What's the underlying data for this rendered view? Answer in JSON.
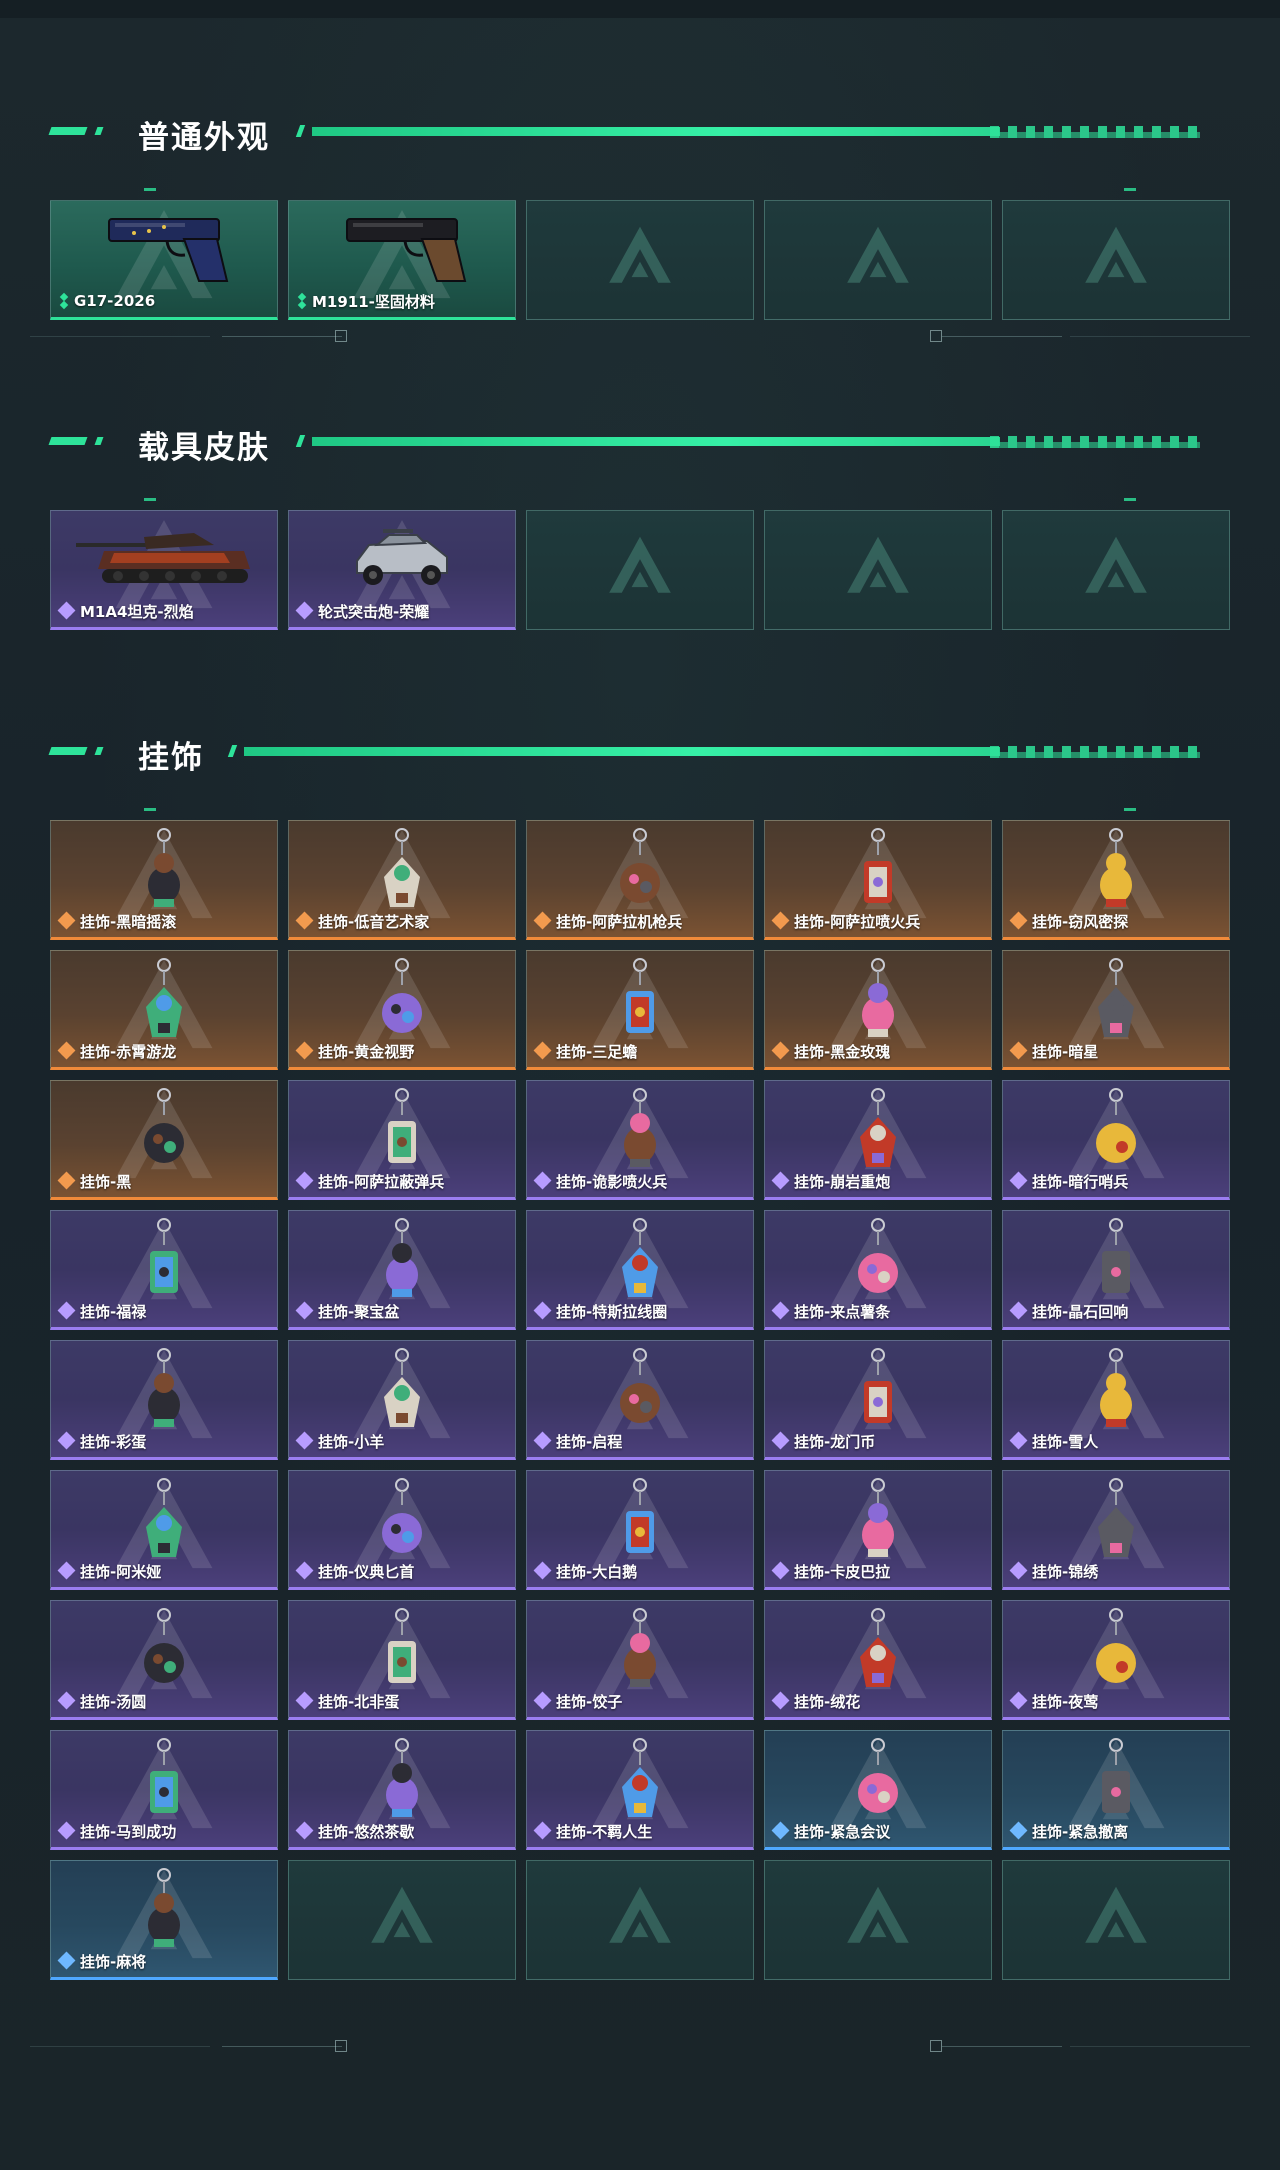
{
  "colors": {
    "accent": "#2ee39a",
    "rarity_green": "#2ee39a",
    "rarity_purple": "#9b7df0",
    "rarity_orange": "#f08a3a",
    "rarity_blue": "#4fa8ff"
  },
  "sections": [
    {
      "title": "普通外观",
      "items": [
        {
          "label": "G17-2026",
          "rarity": "green",
          "icon": "pistol-icon"
        },
        {
          "label": "M1911-坚固材料",
          "rarity": "green",
          "icon": "pistol-icon"
        },
        {
          "label": "",
          "rarity": "empty",
          "icon": "logo-placeholder-icon"
        },
        {
          "label": "",
          "rarity": "empty",
          "icon": "logo-placeholder-icon"
        },
        {
          "label": "",
          "rarity": "empty",
          "icon": "logo-placeholder-icon"
        }
      ]
    },
    {
      "title": "载具皮肤",
      "items": [
        {
          "label": "M1A4坦克-烈焰",
          "rarity": "purple",
          "icon": "tank-icon"
        },
        {
          "label": "轮式突击炮-荣耀",
          "rarity": "purple",
          "icon": "armored-vehicle-icon"
        },
        {
          "label": "",
          "rarity": "empty",
          "icon": "logo-placeholder-icon"
        },
        {
          "label": "",
          "rarity": "empty",
          "icon": "logo-placeholder-icon"
        },
        {
          "label": "",
          "rarity": "empty",
          "icon": "logo-placeholder-icon"
        }
      ]
    },
    {
      "title": "挂饰",
      "items": [
        {
          "label": "挂饰-黑暗摇滚",
          "rarity": "orange",
          "icon": "charm-icon"
        },
        {
          "label": "挂饰-低音艺术家",
          "rarity": "orange",
          "icon": "charm-icon"
        },
        {
          "label": "挂饰-阿萨拉机枪兵",
          "rarity": "orange",
          "icon": "charm-icon"
        },
        {
          "label": "挂饰-阿萨拉喷火兵",
          "rarity": "orange",
          "icon": "charm-icon"
        },
        {
          "label": "挂饰-窃风密探",
          "rarity": "orange",
          "icon": "charm-icon"
        },
        {
          "label": "挂饰-赤霄游龙",
          "rarity": "orange",
          "icon": "charm-icon"
        },
        {
          "label": "挂饰-黄金视野",
          "rarity": "orange",
          "icon": "charm-icon"
        },
        {
          "label": "挂饰-三足蟾",
          "rarity": "orange",
          "icon": "charm-icon"
        },
        {
          "label": "挂饰-黑金玫瑰",
          "rarity": "orange",
          "icon": "charm-icon"
        },
        {
          "label": "挂饰-暗星",
          "rarity": "orange",
          "icon": "charm-icon"
        },
        {
          "label": "挂饰-黑",
          "rarity": "orange",
          "icon": "charm-icon"
        },
        {
          "label": "挂饰-阿萨拉蔽弹兵",
          "rarity": "purple",
          "icon": "charm-icon"
        },
        {
          "label": "挂饰-诡影喷火兵",
          "rarity": "purple",
          "icon": "charm-icon"
        },
        {
          "label": "挂饰-崩岩重炮",
          "rarity": "purple",
          "icon": "charm-icon"
        },
        {
          "label": "挂饰-暗行哨兵",
          "rarity": "purple",
          "icon": "charm-icon"
        },
        {
          "label": "挂饰-福禄",
          "rarity": "purple",
          "icon": "charm-icon"
        },
        {
          "label": "挂饰-聚宝盆",
          "rarity": "purple",
          "icon": "charm-icon"
        },
        {
          "label": "挂饰-特斯拉线圈",
          "rarity": "purple",
          "icon": "charm-icon"
        },
        {
          "label": "挂饰-来点薯条",
          "rarity": "purple",
          "icon": "charm-icon"
        },
        {
          "label": "挂饰-晶石回响",
          "rarity": "purple",
          "icon": "charm-icon"
        },
        {
          "label": "挂饰-彩蛋",
          "rarity": "purple",
          "icon": "charm-icon"
        },
        {
          "label": "挂饰-小羊",
          "rarity": "purple",
          "icon": "charm-icon"
        },
        {
          "label": "挂饰-启程",
          "rarity": "purple",
          "icon": "charm-icon"
        },
        {
          "label": "挂饰-龙门币",
          "rarity": "purple",
          "icon": "charm-icon"
        },
        {
          "label": "挂饰-雪人",
          "rarity": "purple",
          "icon": "charm-icon"
        },
        {
          "label": "挂饰-阿米娅",
          "rarity": "purple",
          "icon": "charm-icon"
        },
        {
          "label": "挂饰-仪典匕首",
          "rarity": "purple",
          "icon": "charm-icon"
        },
        {
          "label": "挂饰-大白鹅",
          "rarity": "purple",
          "icon": "charm-icon"
        },
        {
          "label": "挂饰-卡皮巴拉",
          "rarity": "purple",
          "icon": "charm-icon"
        },
        {
          "label": "挂饰-锦绣",
          "rarity": "purple",
          "icon": "charm-icon"
        },
        {
          "label": "挂饰-汤圆",
          "rarity": "purple",
          "icon": "charm-icon"
        },
        {
          "label": "挂饰-北非蛋",
          "rarity": "purple",
          "icon": "charm-icon"
        },
        {
          "label": "挂饰-饺子",
          "rarity": "purple",
          "icon": "charm-icon"
        },
        {
          "label": "挂饰-绒花",
          "rarity": "purple",
          "icon": "charm-icon"
        },
        {
          "label": "挂饰-夜莺",
          "rarity": "purple",
          "icon": "charm-icon"
        },
        {
          "label": "挂饰-马到成功",
          "rarity": "purple",
          "icon": "charm-icon"
        },
        {
          "label": "挂饰-悠然茶歇",
          "rarity": "purple",
          "icon": "charm-icon"
        },
        {
          "label": "挂饰-不羁人生",
          "rarity": "purple",
          "icon": "charm-icon"
        },
        {
          "label": "挂饰-紧急会议",
          "rarity": "blue",
          "icon": "charm-icon"
        },
        {
          "label": "挂饰-紧急撤离",
          "rarity": "blue",
          "icon": "charm-icon"
        },
        {
          "label": "挂饰-麻将",
          "rarity": "blue",
          "icon": "charm-icon"
        },
        {
          "label": "",
          "rarity": "empty",
          "icon": "logo-placeholder-icon"
        },
        {
          "label": "",
          "rarity": "empty",
          "icon": "logo-placeholder-icon"
        },
        {
          "label": "",
          "rarity": "empty",
          "icon": "logo-placeholder-icon"
        },
        {
          "label": "",
          "rarity": "empty",
          "icon": "logo-placeholder-icon"
        }
      ]
    }
  ]
}
